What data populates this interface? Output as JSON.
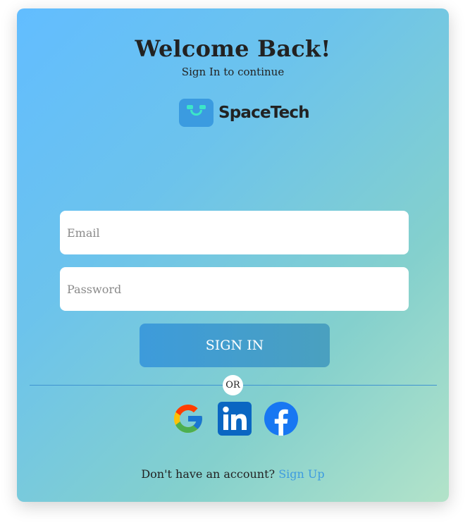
{
  "header": {
    "title": "Welcome Back!",
    "subtitle": "Sign In to continue"
  },
  "brand": {
    "name": "SpaceTech",
    "logo_icon": "robot-face-icon",
    "logo_color": "#3b9be0"
  },
  "form": {
    "email_placeholder": "Email",
    "password_placeholder": "Password",
    "submit_label": "SIGN IN"
  },
  "divider": {
    "label": "OR"
  },
  "social": [
    {
      "icon": "google-icon"
    },
    {
      "icon": "linkedin-icon"
    },
    {
      "icon": "facebook-icon"
    }
  ],
  "footer": {
    "prompt": "Don't have an account?",
    "link_label": "Sign Up"
  },
  "colors": {
    "accent": "#3d9be0",
    "linkedin": "#0a66c2",
    "facebook": "#1877f2"
  }
}
